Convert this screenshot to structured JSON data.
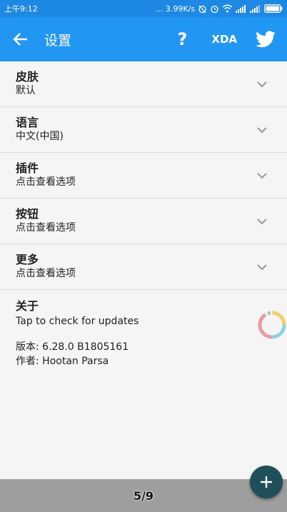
{
  "statusbar": {
    "time": "上午9:12",
    "speed": "... 3.99K/s"
  },
  "appbar": {
    "title": "设置",
    "help_label": "?",
    "xda_label": "XDA"
  },
  "settings": [
    {
      "title": "皮肤",
      "subtitle": "默认"
    },
    {
      "title": "语言",
      "subtitle": "中文(中国)"
    },
    {
      "title": "插件",
      "subtitle": "点击查看选项"
    },
    {
      "title": "按钮",
      "subtitle": "点击查看选项"
    },
    {
      "title": "更多",
      "subtitle": "点击查看选项"
    }
  ],
  "about": {
    "title": "关于",
    "update_hint": "Tap to check for updates",
    "version": "版本: 6.28.0  B1805161",
    "author": "作者: Hootan Parsa"
  },
  "pager": {
    "indicator": "5/9"
  },
  "colors": {
    "primary": "#2196F3",
    "status": "#1E88E5",
    "fab": "#1f4f58"
  }
}
